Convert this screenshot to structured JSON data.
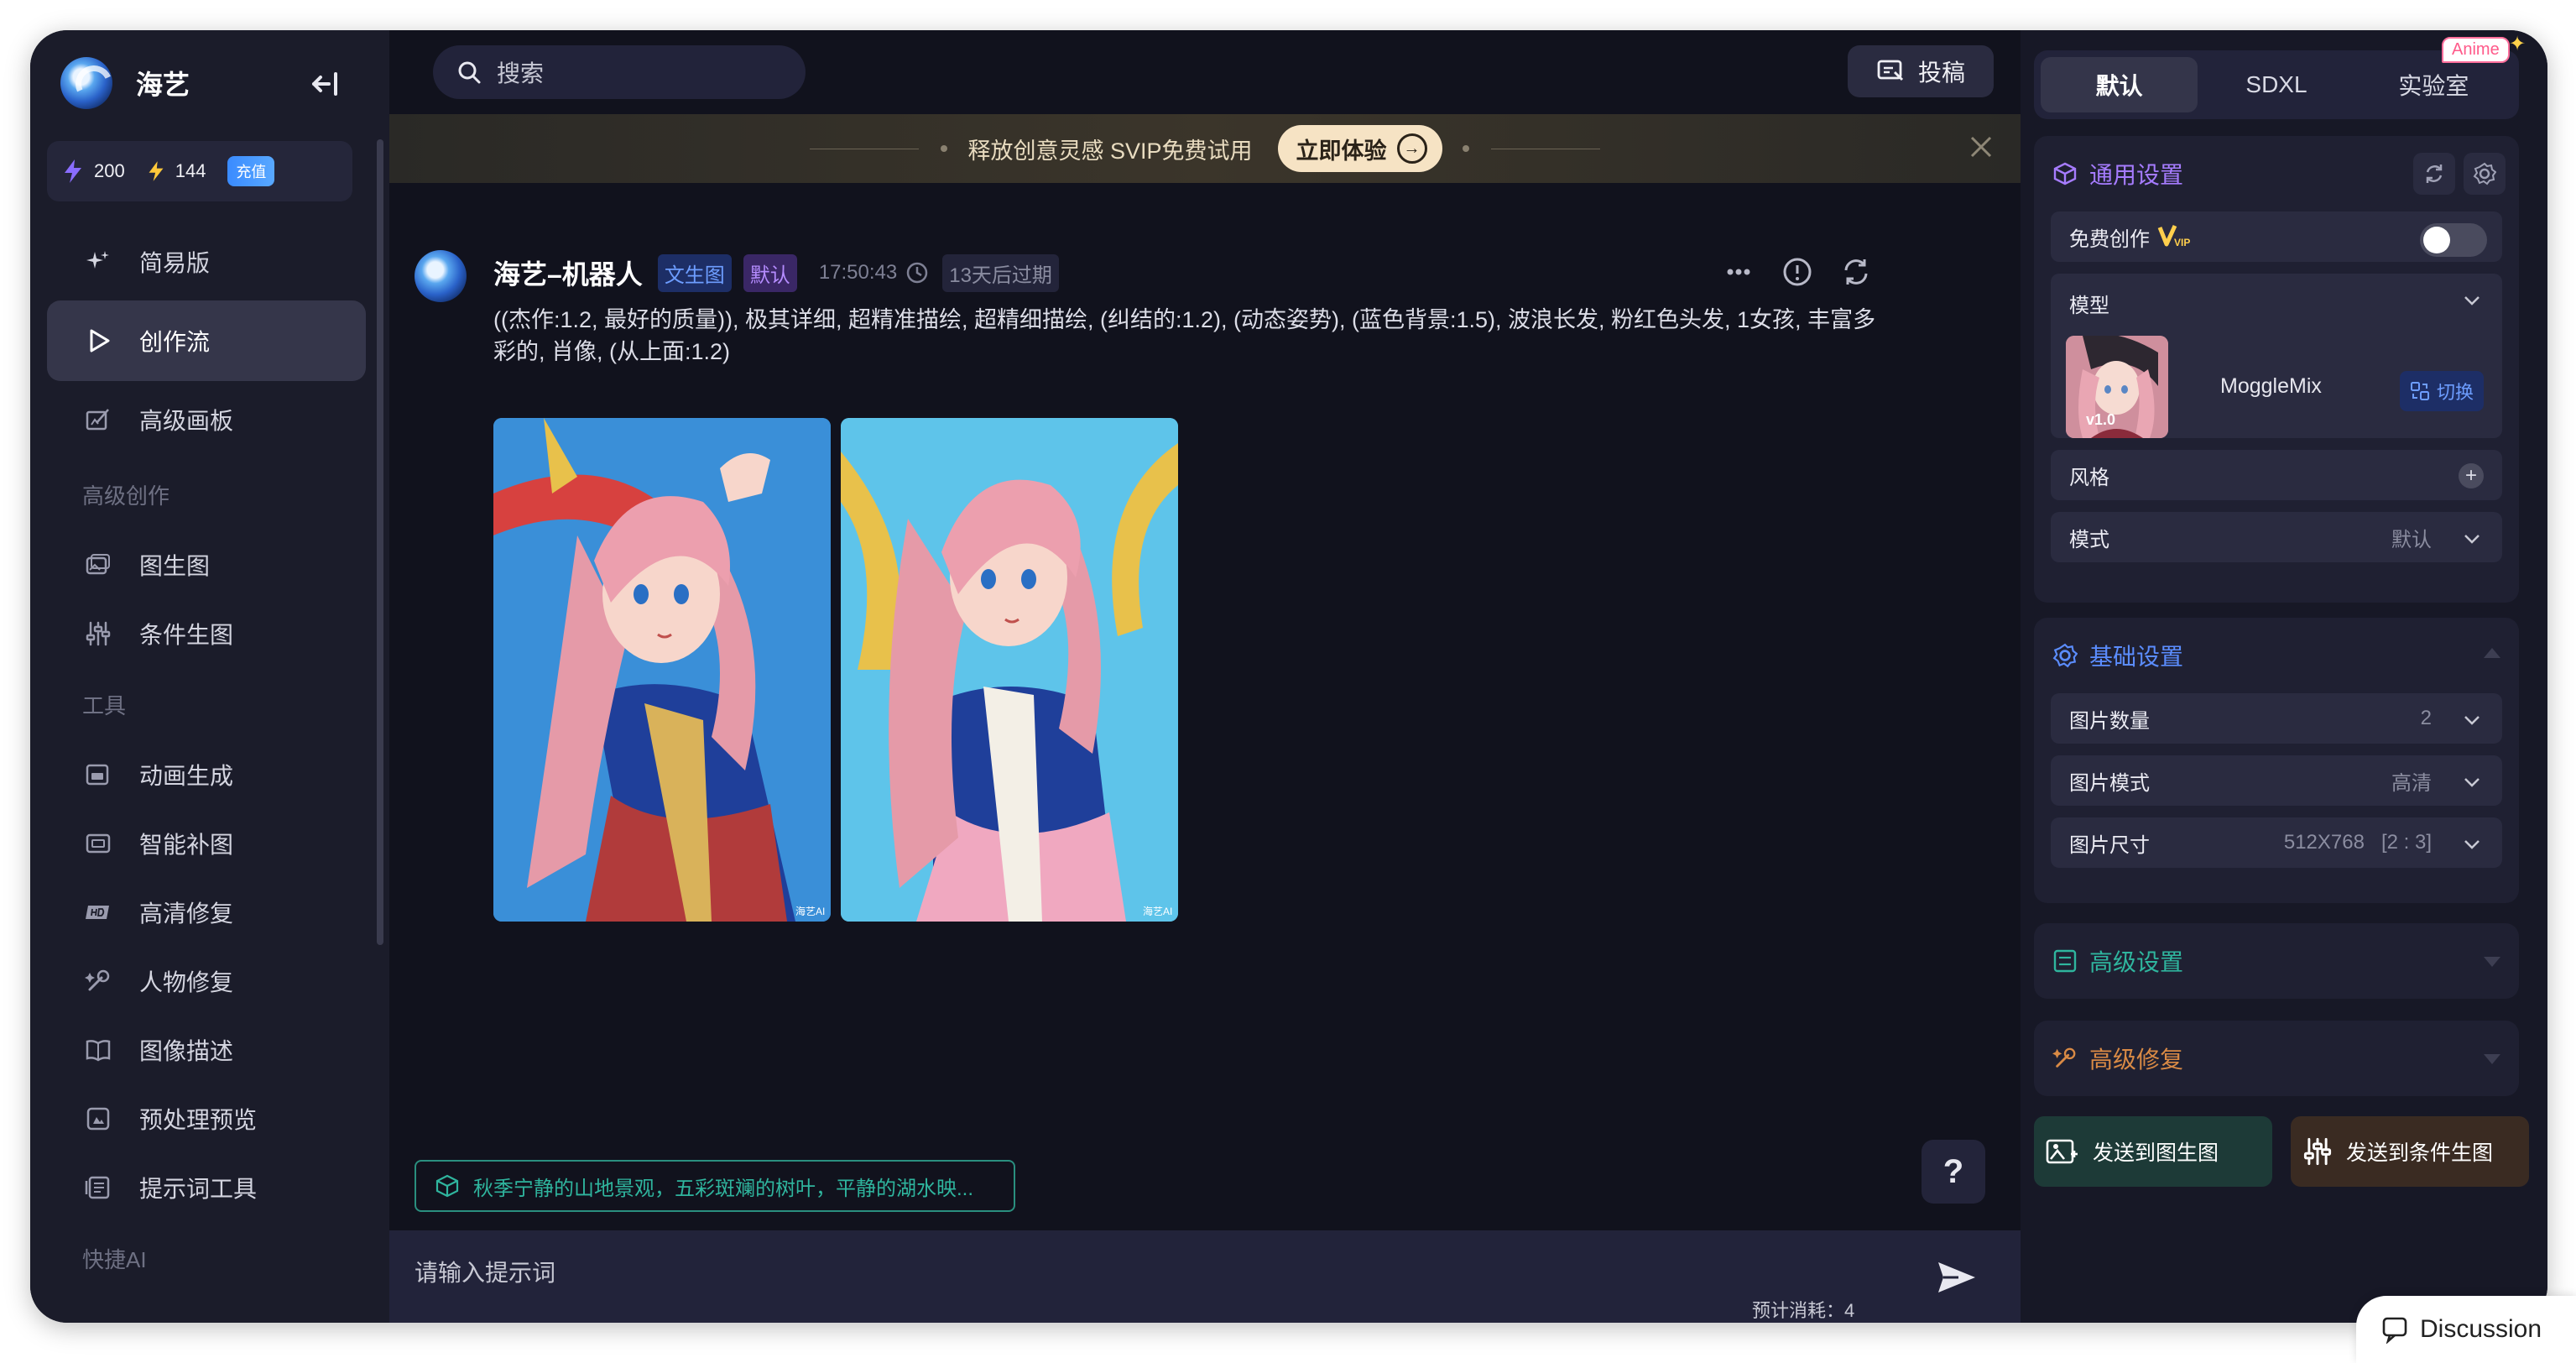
{
  "app": {
    "name": "海艺"
  },
  "sidebar": {
    "credits": "200",
    "energy": "144",
    "recharge_label": "充值",
    "items": [
      {
        "label": "简易版",
        "icon": "sparkle-icon"
      },
      {
        "label": "创作流",
        "icon": "play-icon",
        "active": true
      },
      {
        "label": "高级画板",
        "icon": "canvas-icon"
      }
    ],
    "section_advanced": "高级创作",
    "advanced_items": [
      {
        "label": "图生图",
        "icon": "image-to-image-icon"
      },
      {
        "label": "条件生图",
        "icon": "sliders-icon"
      }
    ],
    "section_tools": "工具",
    "tool_items": [
      {
        "label": "动画生成",
        "icon": "gif-icon"
      },
      {
        "label": "智能补图",
        "icon": "inpaint-icon"
      },
      {
        "label": "高清修复",
        "icon": "hd-icon"
      },
      {
        "label": "人物修复",
        "icon": "repair-icon"
      },
      {
        "label": "图像描述",
        "icon": "book-icon"
      },
      {
        "label": "预处理预览",
        "icon": "preview-icon"
      },
      {
        "label": "提示词工具",
        "icon": "prompt-tool-icon"
      }
    ],
    "section_quick": "快捷AI"
  },
  "topbar": {
    "search_placeholder": "搜索",
    "submit_label": "投稿"
  },
  "banner": {
    "text": "释放创意灵感 SVIP免费试用",
    "cta": "立即体验"
  },
  "message": {
    "sender": "海艺–机器人",
    "tag_type": "文生图",
    "tag_mode": "默认",
    "time": "17:50:43",
    "expire": "13天后过期",
    "prompt": "((杰作:1.2, 最好的质量)), 极其详细, 超精准描绘, 超精细描绘, (纠结的:1.2), (动态姿势), (蓝色背景:1.5), 波浪长发, 粉红色头发, 1女孩, 丰富多彩的, 肖像, (从上面:1.2)",
    "watermark": "海艺AI"
  },
  "suggestion": "秋季宁静的山地景观，五彩斑斓的树叶，平静的湖水映...",
  "help_label": "?",
  "input": {
    "placeholder": "请输入提示词",
    "cost": "预计消耗：4"
  },
  "right_panel": {
    "tabs": [
      "默认",
      "SDXL",
      "实验室"
    ],
    "anime_badge": "Anime",
    "general": {
      "title": "通用设置",
      "free_create_label": "免费创作",
      "vip_label": "VIP",
      "model_label": "模型",
      "model_name": "MoggleMix",
      "model_version": "v1.0",
      "switch_label": "切换",
      "style_label": "风格",
      "mode_label": "模式",
      "mode_value": "默认"
    },
    "basic": {
      "title": "基础设置",
      "count_label": "图片数量",
      "count_value": "2",
      "quality_label": "图片模式",
      "quality_value": "高清",
      "size_label": "图片尺寸",
      "size_value": "512X768   [2 : 3]"
    },
    "advanced_title": "高级设置",
    "repair_title": "高级修复",
    "send_img2img": "发送到图生图",
    "send_controlnet": "发送到条件生图"
  },
  "discussion_label": "Discussion",
  "colors": {
    "accent_blue": "#6d9dff",
    "accent_purple": "#a67cff",
    "accent_green": "#2fb59e",
    "accent_orange": "#d98a45"
  }
}
